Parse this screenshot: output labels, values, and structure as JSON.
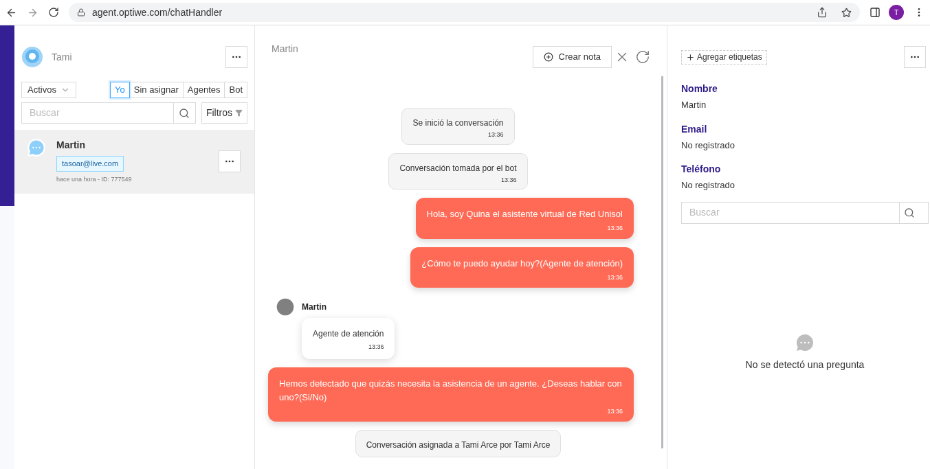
{
  "browser": {
    "url": "agent.optiwe.com/chatHandler",
    "profile_initial": "T"
  },
  "sidebar": {
    "agent_name": "Tami",
    "status_filter": "Activos",
    "tabs": [
      {
        "label": "Yo",
        "selected": true
      },
      {
        "label": "Sin asignar",
        "selected": false
      },
      {
        "label": "Agentes",
        "selected": false
      },
      {
        "label": "Bot",
        "selected": false
      }
    ],
    "search": {
      "placeholder": "Buscar"
    },
    "filters_button": "Filtros",
    "conversations": [
      {
        "name": "Martin",
        "email": "tasoar@live.com",
        "meta": "hace una hora - ID: 777549",
        "selected": true
      }
    ]
  },
  "chat": {
    "contact_name": "Martin",
    "note_button": "Crear nota",
    "messages": [
      {
        "kind": "system",
        "text": "Se inició la conversación",
        "time": "13:36"
      },
      {
        "kind": "system",
        "text": "Conversación tomada por el bot",
        "time": "13:36"
      },
      {
        "kind": "bot",
        "text": "Hola, soy Quina el asistente virtual de Red Unisol",
        "time": "13:36"
      },
      {
        "kind": "bot",
        "text": "¿Cómo te puedo ayudar hoy?(Agente de atención)",
        "time": "13:36"
      },
      {
        "kind": "user",
        "sender": "Martin",
        "text": "Agente de atención",
        "time": "13:36"
      },
      {
        "kind": "bot",
        "text": "Hemos detectado que quizás necesita la asistencia de un agente. ¿Deseas hablar con uno?(Si/No)",
        "time": "13:36"
      },
      {
        "kind": "system",
        "text": "Conversación asignada a Tami Arce por Tami Arce"
      }
    ]
  },
  "details": {
    "tags_button": "Agregar etiquetas",
    "fields": [
      {
        "label": "Nombre",
        "value": "Martin"
      },
      {
        "label": "Email",
        "value": "No registrado"
      },
      {
        "label": "Teléfono",
        "value": "No registrado"
      }
    ],
    "search": {
      "placeholder": "Buscar"
    },
    "empty_message": "No se detectó una pregunta"
  }
}
